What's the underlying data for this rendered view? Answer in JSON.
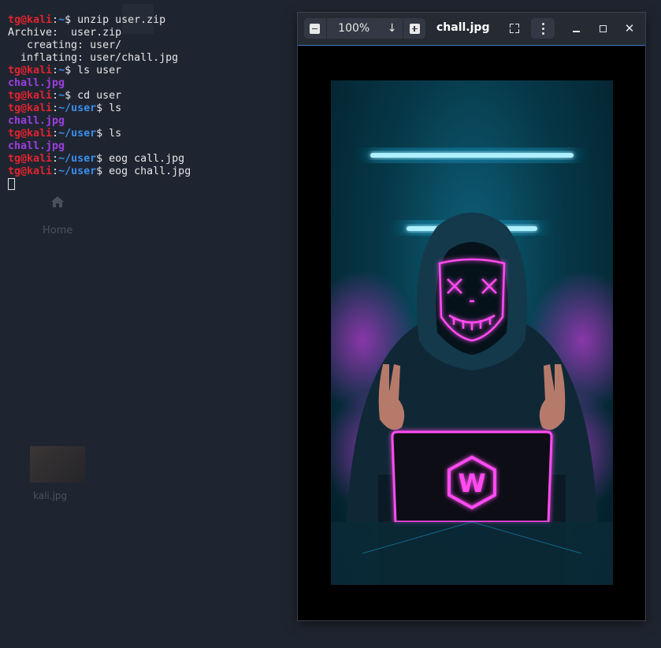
{
  "desktop": {
    "home_label": "Home",
    "thumb_label": "kali.jpg"
  },
  "terminal": {
    "lines": [
      {
        "user": "tg@kali",
        "path": "~",
        "cmd": "unzip user.zip"
      },
      {
        "out": "Archive:  user.zip"
      },
      {
        "out": "   creating: user/"
      },
      {
        "out": "  inflating: user/chall.jpg"
      },
      {
        "user": "tg@kali",
        "path": "~",
        "cmd": "ls user"
      },
      {
        "dir": "chall.jpg"
      },
      {
        "user": "tg@kali",
        "path": "~",
        "cmd": "cd user"
      },
      {
        "user": "tg@kali",
        "path": "~/user",
        "cmd": "ls"
      },
      {
        "dir": "chall.jpg"
      },
      {
        "user": "tg@kali",
        "path": "~/user",
        "cmd": "ls"
      },
      {
        "dir": "chall.jpg"
      },
      {
        "user": "tg@kali",
        "path": "~/user",
        "cmd": "eog call.jpg"
      },
      {
        "user": "tg@kali",
        "path": "~/user",
        "cmd": "eog chall.jpg"
      }
    ]
  },
  "viewer": {
    "title": "chall.jpg",
    "zoom": "100%",
    "zoom_out_icon": "minus-box-icon",
    "zoom_in_icon": "plus-box-icon",
    "zoom_dropdown_icon": "down-arrow-icon",
    "accent": "#3f78c7"
  },
  "colors": {
    "user": "#e0242f",
    "path": "#3b8eea",
    "directory": "#9b3fe0",
    "background": "#1f2530"
  }
}
